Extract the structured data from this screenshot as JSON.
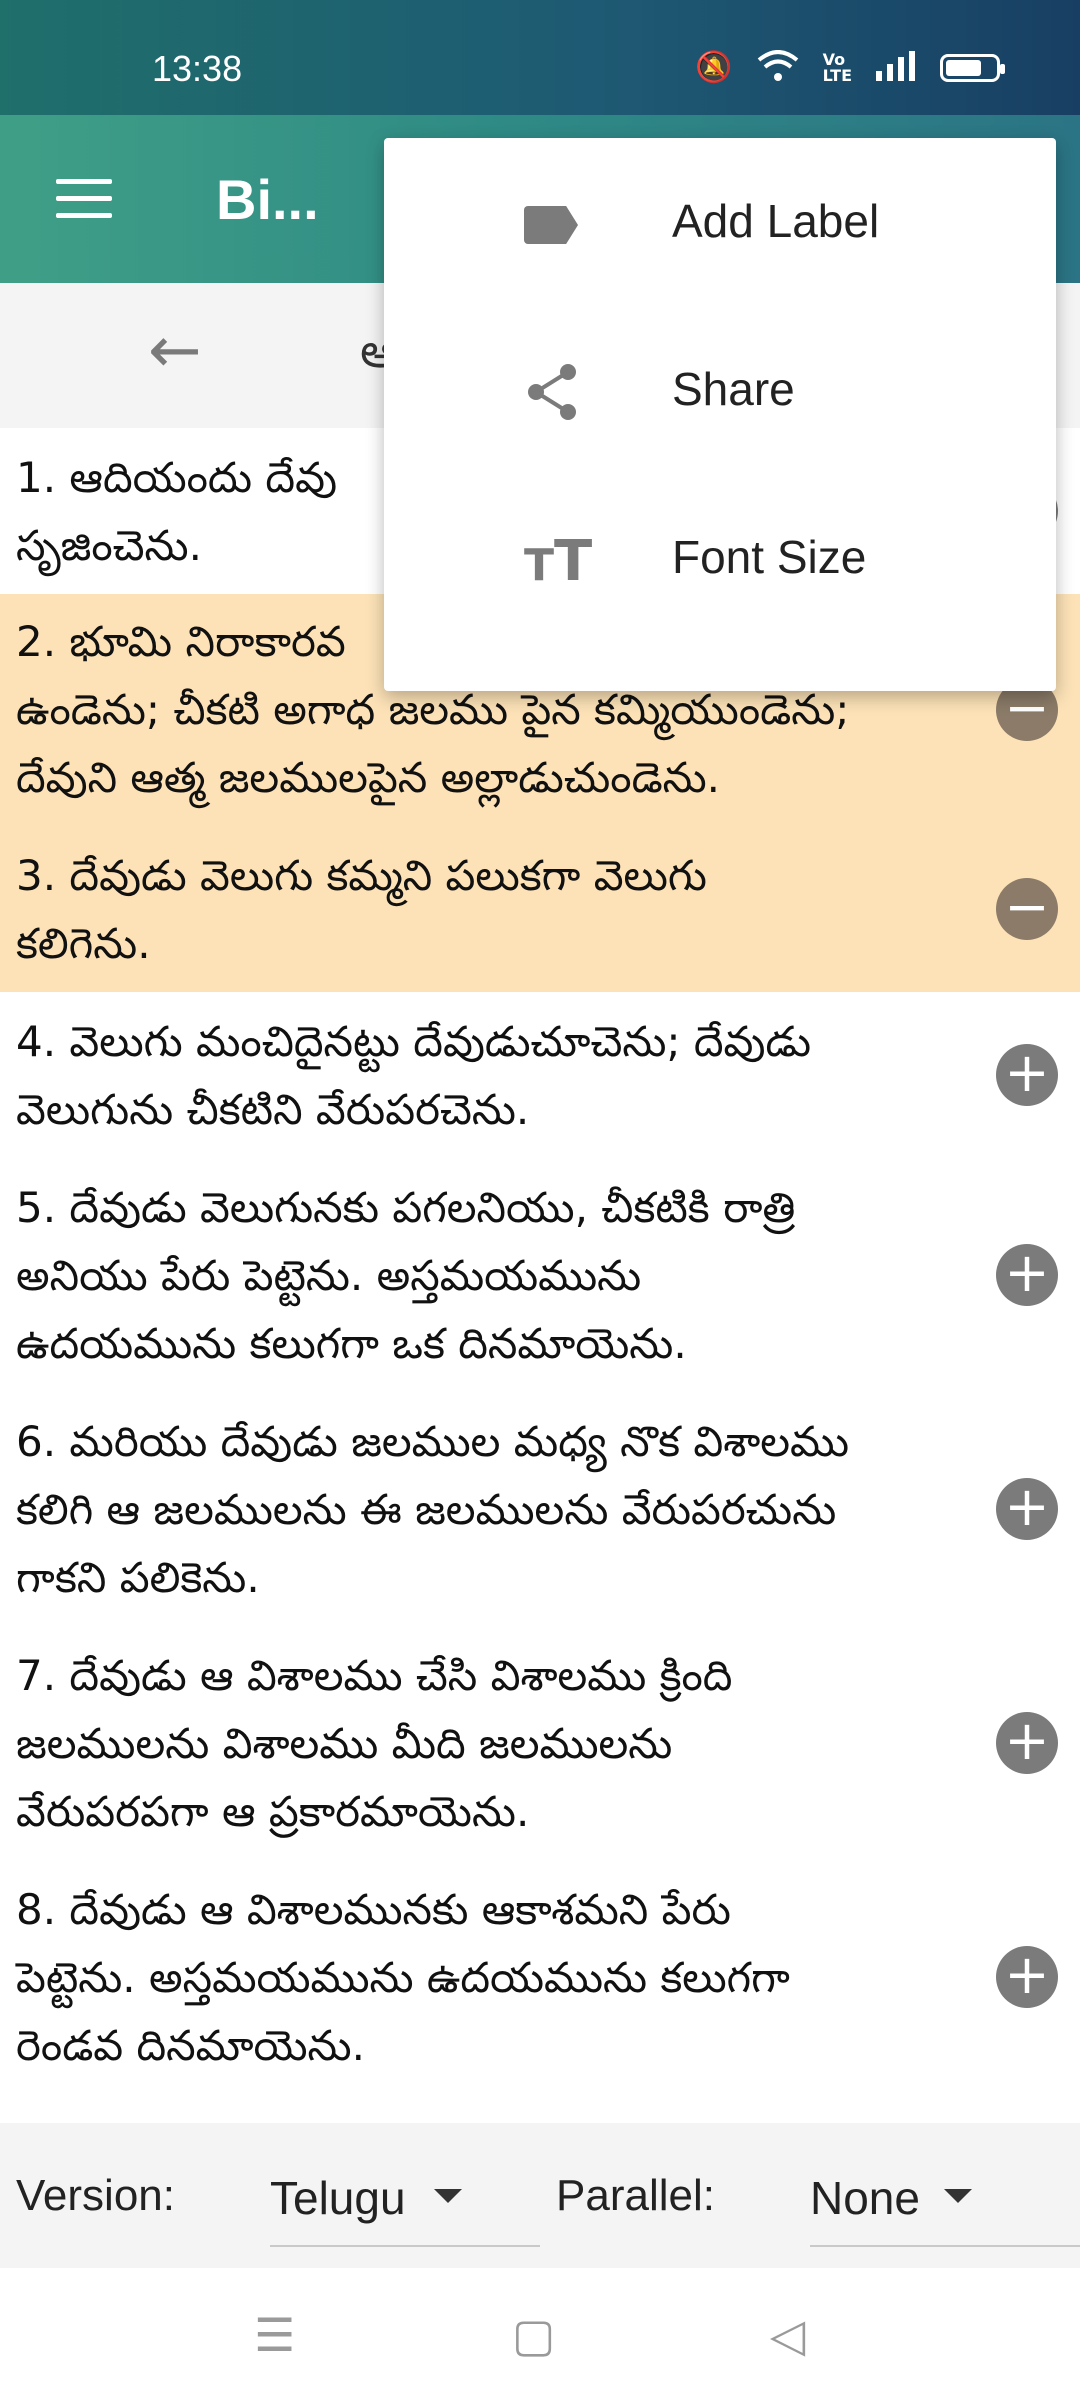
{
  "status": {
    "time": "13:38",
    "icons": [
      "mute-icon",
      "wifi-icon",
      "volte-icon",
      "signal-icon",
      "battery-icon"
    ]
  },
  "app_bar": {
    "title": "Bi..."
  },
  "nav": {
    "chapter": "ఆ"
  },
  "verses": [
    {
      "text": "1. ఆదియందు దేవు",
      "text2": "సృజించెను.",
      "highlighted": false,
      "action": "add"
    },
    {
      "text": "2. భూమి నిరాకారవ",
      "text2": "ఉండెను; చీకటి అగాధ జలము పైన కమ్మియుండెను;",
      "text3": "దేవుని ఆత్మ జలములపైన అల్లాడుచుండెను.",
      "highlighted": true,
      "action": "remove"
    },
    {
      "text": "3. దేవుడు వెలుగు కమ్మని  పలుకగా వెలుగు",
      "text2": "కలిగెను.",
      "highlighted": true,
      "action": "remove"
    },
    {
      "text": "4. వెలుగు మంచిదైనట్టు దేవుడుచూచెను; దేవుడు",
      "text2": "వెలుగును చీకటిని వేరుపరచెను.",
      "highlighted": false,
      "action": "add"
    },
    {
      "text": "5. దేవుడు వెలుగునకు పగలనియు, చీకటికి రాత్రి",
      "text2": "అనియు పేరు పెట్టెను. అస్తమయమును",
      "text3": "ఉదయమును కలుగగా ఒక దినమాయెను.",
      "highlighted": false,
      "action": "add"
    },
    {
      "text": "6. మరియు దేవుడు జలముల మధ్య నొక విశాలము",
      "text2": "కలిగి ఆ జలములను ఈ జలములను వేరుపరచును",
      "text3": "గాకని పలికెను.",
      "highlighted": false,
      "action": "add"
    },
    {
      "text": "7. దేవుడు ఆ విశాలము చేసి విశాలము క్రింది",
      "text2": "జలములను విశాలము మీది జలములను",
      "text3": "వేరుపరపగా ఆ ప్రకారమాయెను.",
      "highlighted": false,
      "action": "add"
    },
    {
      "text": "8. దేవుడు ఆ విశాలమునకు ఆకాశమని పేరు",
      "text2": "పెట్టెను. అస్తమయమును ఉదయమును కలుగగా",
      "text3": "రెండవ దినమాయెను.",
      "highlighted": false,
      "action": "add"
    }
  ],
  "bottom": {
    "version_label": "Version:",
    "version_value": "Telugu",
    "parallel_label": "Parallel:",
    "parallel_value": "None"
  },
  "menu": {
    "items": [
      "Add Label",
      "Share",
      "Font Size"
    ]
  },
  "colors": {
    "accent": "#2f8b85",
    "highlight": "#fde2b7"
  }
}
